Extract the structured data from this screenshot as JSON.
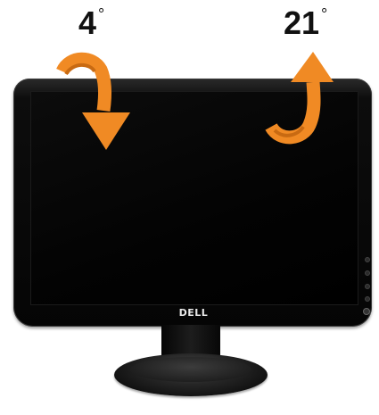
{
  "angles": {
    "forward_value": "4",
    "back_value": "21",
    "degree_symbol": "°"
  },
  "monitor": {
    "logo_text": "DELL"
  },
  "icons": {
    "forward_tilt": "curved-arrow-down-icon",
    "back_tilt": "curved-arrow-up-icon"
  },
  "colors": {
    "arrow": "#f08a24",
    "bezel": "#0a0a0a",
    "background": "#ffffff"
  }
}
